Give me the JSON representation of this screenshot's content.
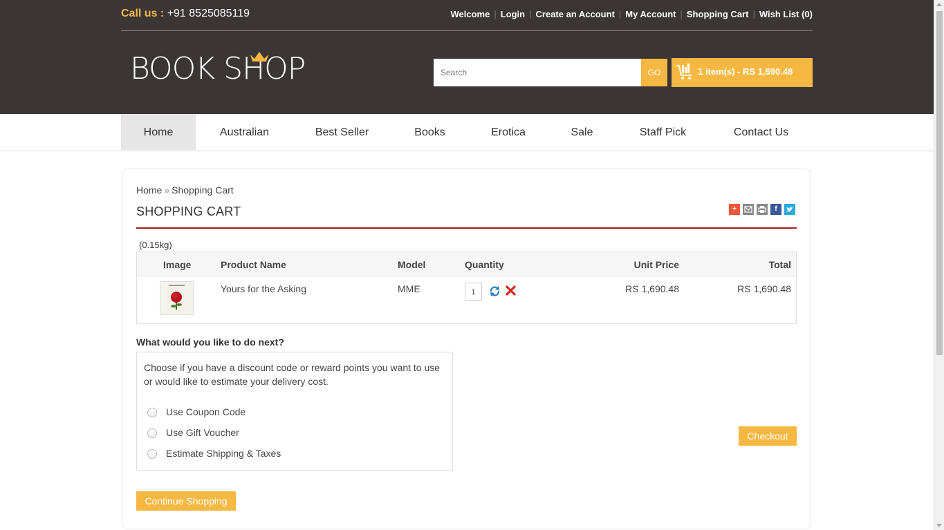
{
  "header": {
    "call_label": "Call us :",
    "phone": "+91 8525085119",
    "links": [
      "Welcome",
      "Login",
      "Create an Account",
      "My Account",
      "Shopping Cart",
      "Wish List (0)"
    ],
    "logo_text": "BOOK SHOP",
    "search_placeholder": "Search",
    "go_label": "GO",
    "cart_summary": "1 item(s) - RS 1,690.48"
  },
  "nav": {
    "items": [
      "Home",
      "Australian",
      "Best Seller",
      "Books",
      "Erotica",
      "Sale",
      "Staff Pick",
      "Contact Us"
    ],
    "active": "Home"
  },
  "breadcrumb": {
    "home": "Home",
    "separator": "»",
    "current": "Shopping Cart"
  },
  "page_title": "SHOPPING CART",
  "share_icons": [
    "addthis-icon",
    "email-icon",
    "print-icon",
    "facebook-icon",
    "twitter-icon"
  ],
  "weight": "(0.15kg)",
  "table": {
    "headers": {
      "image": "Image",
      "product": "Product Name",
      "model": "Model",
      "quantity": "Quantity",
      "unit_price": "Unit Price",
      "total": "Total"
    },
    "rows": [
      {
        "product": "Yours for the Asking",
        "model": "MME",
        "quantity": "1",
        "unit_price": "RS 1,690.48",
        "total": "RS 1,690.48"
      }
    ]
  },
  "next": {
    "title": "What would you like to do next?",
    "description": "Choose if you have a discount code or reward points you want to use or would like to estimate your delivery cost.",
    "options": [
      "Use Coupon Code",
      "Use Gift Voucher",
      "Estimate Shipping & Taxes"
    ]
  },
  "buttons": {
    "checkout": "Checkout",
    "continue": "Continue Shopping"
  },
  "colors": {
    "header_bg": "#3b3536",
    "accent": "#f7b843",
    "title_rule": "#a31d1d"
  }
}
